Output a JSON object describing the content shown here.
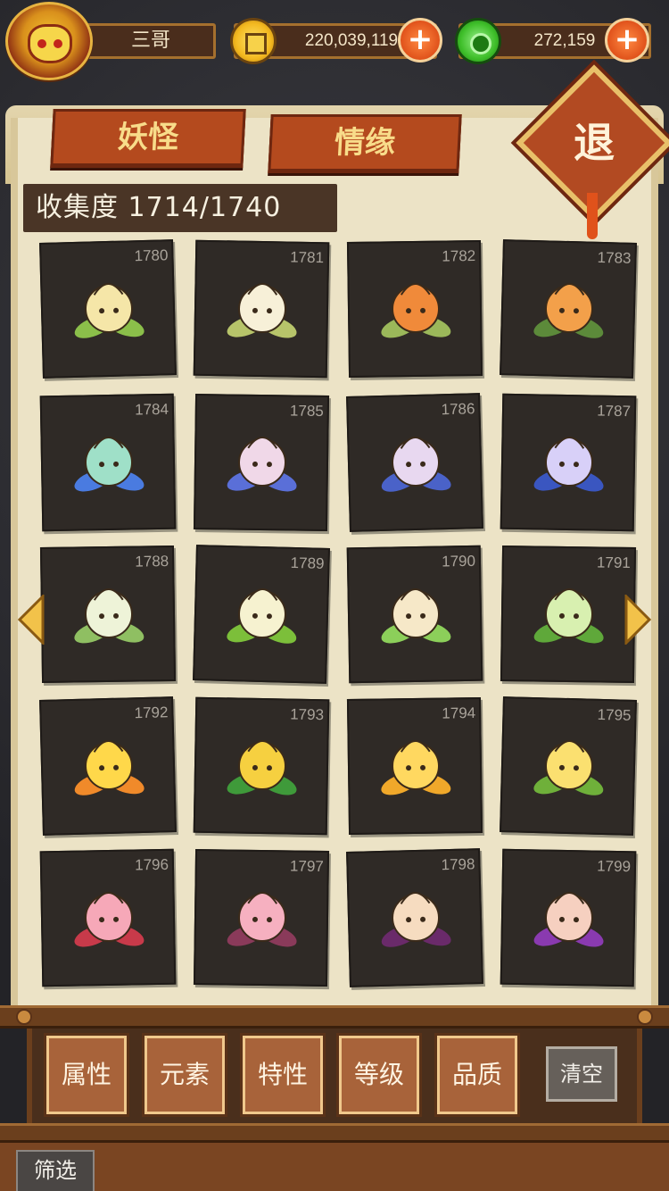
{
  "header": {
    "player_name": "三哥",
    "coin_amount": "220,039,119",
    "jade_amount": "272,159",
    "coin_plus": "+",
    "jade_plus": "+"
  },
  "tabs": [
    {
      "label": "妖怪"
    },
    {
      "label": "情缘"
    }
  ],
  "exit": {
    "label": "退"
  },
  "collection": {
    "label": "收集度",
    "progress": "1714/1740"
  },
  "cards": [
    {
      "num": "1780",
      "color": "#f5e6a8",
      "accent": "#8bbf4a"
    },
    {
      "num": "1781",
      "color": "#f7f0d8",
      "accent": "#b7c46a"
    },
    {
      "num": "1782",
      "color": "#f08a3a",
      "accent": "#9bb85a"
    },
    {
      "num": "1783",
      "color": "#f3a04a",
      "accent": "#5c8a3a"
    },
    {
      "num": "1784",
      "color": "#9fe0c8",
      "accent": "#4a7be0"
    },
    {
      "num": "1785",
      "color": "#f0d8e8",
      "accent": "#5a6fd8"
    },
    {
      "num": "1786",
      "color": "#e8d8f0",
      "accent": "#4a62c8"
    },
    {
      "num": "1787",
      "color": "#d8d0f8",
      "accent": "#3a56c0"
    },
    {
      "num": "1788",
      "color": "#eef3d8",
      "accent": "#8fbf62"
    },
    {
      "num": "1789",
      "color": "#f6f2d0",
      "accent": "#7cbf3a"
    },
    {
      "num": "1790",
      "color": "#f6e8c8",
      "accent": "#8ccf5a"
    },
    {
      "num": "1791",
      "color": "#d8f0b0",
      "accent": "#5fa83a"
    },
    {
      "num": "1792",
      "color": "#ffd84a",
      "accent": "#f08a2a"
    },
    {
      "num": "1793",
      "color": "#f6d040",
      "accent": "#3f9a3a"
    },
    {
      "num": "1794",
      "color": "#ffd860",
      "accent": "#f0a82a"
    },
    {
      "num": "1795",
      "color": "#fbe070",
      "accent": "#6fb03a"
    },
    {
      "num": "1796",
      "color": "#f6a8b8",
      "accent": "#c83a4a"
    },
    {
      "num": "1797",
      "color": "#f6b0c0",
      "accent": "#8a3a5a"
    },
    {
      "num": "1798",
      "color": "#f6dcc0",
      "accent": "#6a2a6a"
    },
    {
      "num": "1799",
      "color": "#f6d0c0",
      "accent": "#8a3ab0"
    }
  ],
  "filters": [
    {
      "label": "属性"
    },
    {
      "label": "元素"
    },
    {
      "label": "特性"
    },
    {
      "label": "等级"
    },
    {
      "label": "品质"
    }
  ],
  "clear_label": "清空",
  "screen_label": "筛选",
  "icons": {
    "avatar": "demon-mask-icon",
    "coin": "gold-coin-icon",
    "jade": "jade-icon",
    "arrow_left": "arrow-left-icon",
    "arrow_right": "arrow-right-icon"
  }
}
